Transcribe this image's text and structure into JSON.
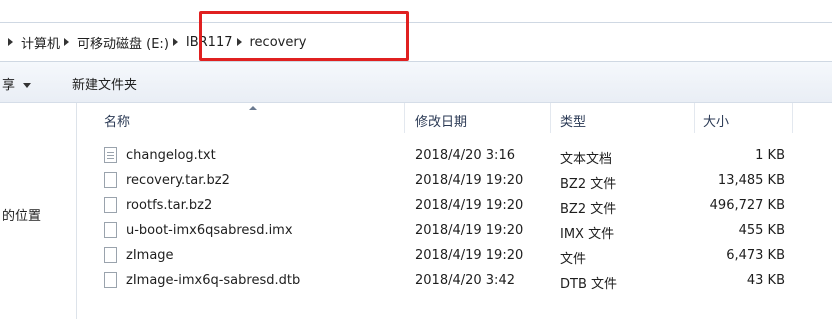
{
  "breadcrumb": {
    "items": [
      "计算机",
      "可移动磁盘 (E:)",
      "IBR117",
      "recovery"
    ]
  },
  "toolbar": {
    "share_label": "享",
    "new_folder_label": "新建文件夹"
  },
  "left_pane": {
    "location_label": "的位置"
  },
  "columns": {
    "name": "名称",
    "date": "修改日期",
    "type": "类型",
    "size": "大小"
  },
  "files": [
    {
      "name": "changelog.txt",
      "date": "2018/4/20 3:16",
      "type": "文本文档",
      "size": "1 KB",
      "icon": "text-file-icon"
    },
    {
      "name": "recovery.tar.bz2",
      "date": "2018/4/19 19:20",
      "type": "BZ2 文件",
      "size": "13,485 KB",
      "icon": "file-icon"
    },
    {
      "name": "rootfs.tar.bz2",
      "date": "2018/4/19 19:20",
      "type": "BZ2 文件",
      "size": "496,727 KB",
      "icon": "file-icon"
    },
    {
      "name": "u-boot-imx6qsabresd.imx",
      "date": "2018/4/19 19:20",
      "type": "IMX 文件",
      "size": "455 KB",
      "icon": "file-icon"
    },
    {
      "name": "zImage",
      "date": "2018/4/19 19:20",
      "type": "文件",
      "size": "6,473 KB",
      "icon": "file-icon"
    },
    {
      "name": "zImage-imx6q-sabresd.dtb",
      "date": "2018/4/20 3:42",
      "type": "DTB 文件",
      "size": "43 KB",
      "icon": "file-icon"
    }
  ],
  "colors": {
    "highlight": "#e02020",
    "header_text": "#2b3a55"
  }
}
